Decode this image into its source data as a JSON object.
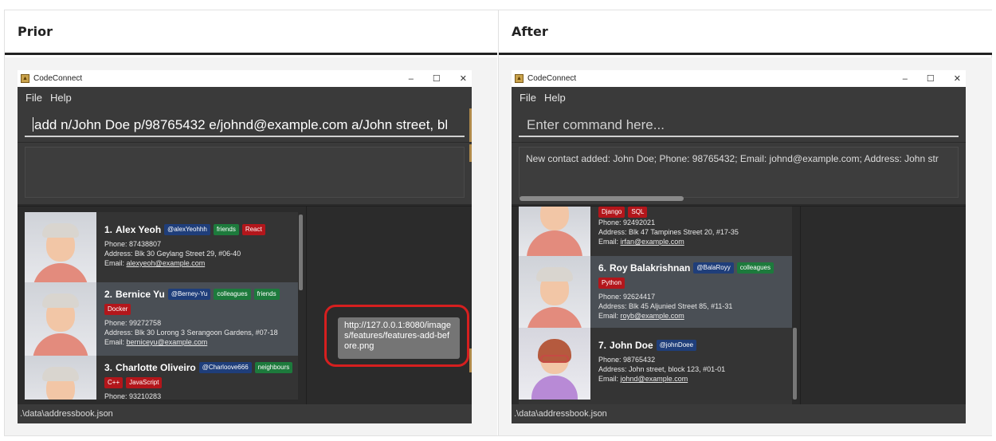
{
  "columns": [
    {
      "heading": "Prior",
      "window_title": "CodeConnect",
      "win_controls": [
        "–",
        "☐",
        "✕"
      ],
      "menu": [
        "File",
        "Help"
      ],
      "command_value": "add n/John Doe p/98765432 e/johnd@example.com a/John street, bl",
      "command_placeholder": "",
      "result_text": "",
      "persons": [
        {
          "index": "1.",
          "name": "Alex Yeoh",
          "tags": [
            {
              "text": "@alexYeohhh",
              "kind": "handle"
            },
            {
              "text": "friends",
              "kind": "green"
            },
            {
              "text": "React",
              "kind": "red"
            }
          ],
          "phone": "Phone: 87438807",
          "address": "Address: Blk 30 Geylang Street 29, #06-40",
          "email_label": "Email:",
          "email": "alexyeoh@example.com"
        },
        {
          "index": "2.",
          "name": "Bernice Yu",
          "tags": [
            {
              "text": "@Berney-Yu",
              "kind": "handle"
            },
            {
              "text": "colleagues",
              "kind": "green"
            },
            {
              "text": "friends",
              "kind": "green"
            },
            {
              "text": "Docker",
              "kind": "red"
            }
          ],
          "phone": "Phone: 99272758",
          "address": "Address: Blk 30 Lorong 3 Serangoon Gardens, #07-18",
          "email_label": "Email:",
          "email": "berniceyu@example.com"
        },
        {
          "index": "3.",
          "name": "Charlotte Oliveiro",
          "tags": [
            {
              "text": "@Charloove666",
              "kind": "handle"
            },
            {
              "text": "neighbours",
              "kind": "green"
            },
            {
              "text": "C++",
              "kind": "red"
            },
            {
              "text": "JavaScript",
              "kind": "red"
            }
          ],
          "phone": "Phone: 93210283",
          "address": "",
          "email_label": "",
          "email": ""
        }
      ],
      "tooltip": "http://127.0.0.1:8080/images/features/features-add-before.png",
      "status": ".\\data\\addressbook.json"
    },
    {
      "heading": "After",
      "window_title": "CodeConnect",
      "win_controls": [
        "–",
        "☐",
        "✕"
      ],
      "menu": [
        "File",
        "Help"
      ],
      "command_value": "",
      "command_placeholder": "Enter command here...",
      "result_text": "New contact added: John Doe; Phone: 98765432; Email: johnd@example.com; Address: John str",
      "persons": [
        {
          "index": "",
          "name": "",
          "tags": [
            {
              "text": "Django",
              "kind": "red"
            },
            {
              "text": "SQL",
              "kind": "red"
            }
          ],
          "phone": "Phone: 92492021",
          "address": "Address: Blk 47 Tampines Street 20, #17-35",
          "email_label": "Email:",
          "email": "irfan@example.com"
        },
        {
          "index": "6.",
          "name": "Roy Balakrishnan",
          "tags": [
            {
              "text": "@BalaRoyy",
              "kind": "handle"
            },
            {
              "text": "colleagues",
              "kind": "green"
            },
            {
              "text": "Python",
              "kind": "red"
            }
          ],
          "phone": "Phone: 92624417",
          "address": "Address: Blk 45 Aljunied Street 85, #11-31",
          "email_label": "Email:",
          "email": "royb@example.com"
        },
        {
          "index": "7.",
          "name": "John Doe",
          "tags": [
            {
              "text": "@johnDoee",
              "kind": "handle"
            }
          ],
          "phone": "Phone: 98765432",
          "address": "Address: John street, block 123, #01-01",
          "email_label": "Email:",
          "email": "johnd@example.com"
        }
      ],
      "tooltip": "",
      "status": ".\\data\\addressbook.json"
    }
  ],
  "colors": {
    "accent_red": "#d61f1f",
    "tag_handle": "#1f3e7a",
    "tag_green": "#1d7a3c",
    "tag_red": "#b3161b"
  }
}
